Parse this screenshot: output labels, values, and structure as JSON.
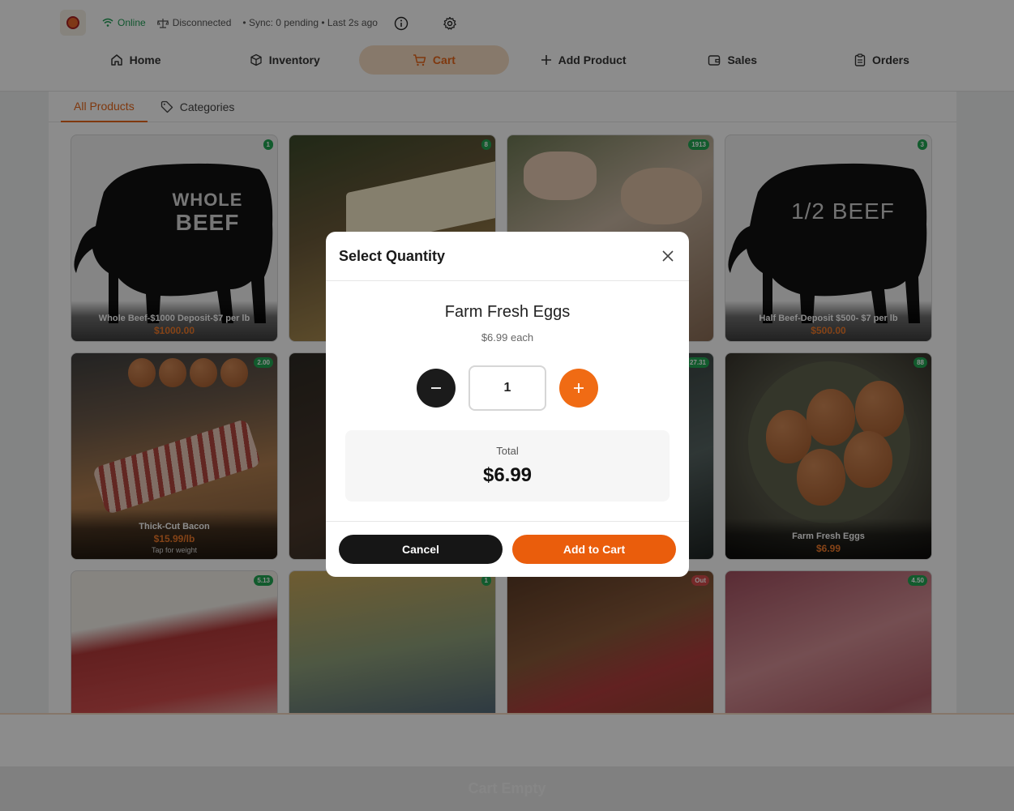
{
  "header": {
    "status": {
      "online": "Online",
      "scale": "Disconnected",
      "sync": "• Sync: 0 pending • Last 2s ago"
    },
    "nav": [
      {
        "label": "Home",
        "icon": "home-icon"
      },
      {
        "label": "Inventory",
        "icon": "box-icon"
      },
      {
        "label": "Cart",
        "icon": "cart-icon",
        "active": true
      },
      {
        "label": "Add Product",
        "icon": "plus-icon"
      },
      {
        "label": "Sales",
        "icon": "wallet-icon"
      },
      {
        "label": "Orders",
        "icon": "clipboard-icon"
      }
    ]
  },
  "tabs": [
    {
      "label": "All Products",
      "active": true
    },
    {
      "label": "Categories",
      "icon": "tag-icon"
    }
  ],
  "products": [
    {
      "name": "Whole Beef-$1000 Deposit-$7 per lb",
      "price": "$1000.00",
      "badge": "1",
      "art_text": [
        "WHOLE",
        "BEEF"
      ]
    },
    {
      "name": "",
      "price": "",
      "badge": "8"
    },
    {
      "name": "",
      "price": "",
      "badge": "1913"
    },
    {
      "name": "Half Beef-Deposit $500- $7 per lb",
      "price": "$500.00",
      "badge": "3",
      "art_text": [
        "1/2 BEEF"
      ]
    },
    {
      "name": "Thick-Cut Bacon",
      "price": "$15.99/lb",
      "hint": "Tap for weight",
      "badge": "2.00"
    },
    {
      "name": "",
      "price": "",
      "badge": ""
    },
    {
      "name": "",
      "price": "",
      "badge": "27.31"
    },
    {
      "name": "Farm Fresh Eggs",
      "price": "$6.99",
      "badge": "88"
    },
    {
      "name": "",
      "price": "",
      "badge": "5.13"
    },
    {
      "name": "",
      "price": "",
      "badge": "1"
    },
    {
      "name": "",
      "price": "",
      "badge": "Out"
    },
    {
      "name": "",
      "price": "",
      "badge": "4.50"
    }
  ],
  "cart": {
    "button_label": "Cart Empty"
  },
  "modal": {
    "title": "Select Quantity",
    "product_name": "Farm Fresh Eggs",
    "unit_price": "$6.99 each",
    "quantity": "1",
    "total_label": "Total",
    "total_value": "$6.99",
    "cancel_label": "Cancel",
    "add_label": "Add to Cart"
  },
  "colors": {
    "accent": "#e8671a",
    "online": "#1f9d55",
    "badge": "#22a653",
    "out_badge": "#d64c4c"
  }
}
